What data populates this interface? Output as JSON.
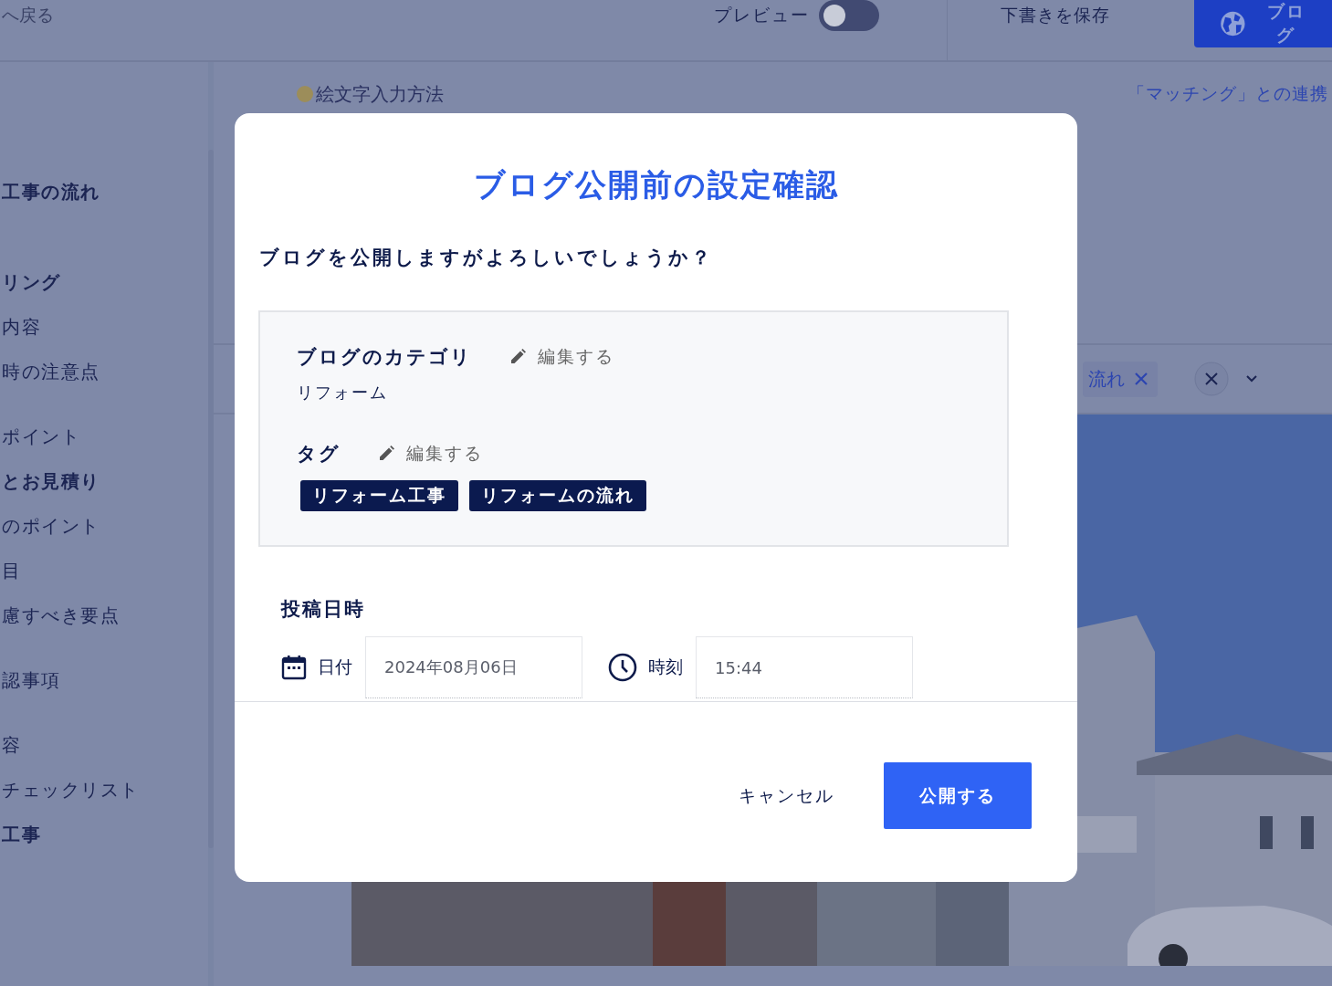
{
  "topbar": {
    "back_link": "へ戻る",
    "preview": {
      "label": "プレビュー",
      "on": false
    },
    "save_draft": "下書きを保存",
    "publish_button": "ブログ"
  },
  "sidebar": {
    "groups": [
      {
        "items": [
          {
            "label": "工事の流れ",
            "kind": "heading"
          }
        ]
      },
      {
        "items": [
          {
            "label": "リング",
            "kind": "heading"
          },
          {
            "label": "内容",
            "kind": "item"
          },
          {
            "label": "時の注意点",
            "kind": "item"
          }
        ]
      },
      {
        "items": [
          {
            "label": "ポイント",
            "kind": "item"
          },
          {
            "label": "とお見積り",
            "kind": "heading"
          },
          {
            "label": "のポイント",
            "kind": "item"
          },
          {
            "label": "目",
            "kind": "item"
          },
          {
            "label": "慮すべき要点",
            "kind": "item"
          }
        ]
      },
      {
        "items": [
          {
            "label": "認事項",
            "kind": "item"
          }
        ]
      },
      {
        "items": [
          {
            "label": "容",
            "kind": "item"
          },
          {
            "label": "チェックリスト",
            "kind": "item"
          },
          {
            "label": "工事",
            "kind": "heading"
          }
        ]
      }
    ]
  },
  "editor": {
    "emoji_help": "絵文字入力方法",
    "matching_link": "「マッチング」との連携",
    "tag_chips": [
      "流れ"
    ]
  },
  "modal": {
    "title": "ブログ公開前の設定確認",
    "question": "ブログを公開しますがよろしいでしょうか？",
    "category": {
      "label": "ブログのカテゴリ",
      "edit_label": "編集する",
      "value": "リフォーム"
    },
    "tags": {
      "label": "タグ",
      "edit_label": "編集する",
      "items": [
        "リフォーム工事",
        "リフォームの流れ"
      ]
    },
    "post_datetime": {
      "label": "投稿日時",
      "date": {
        "label": "日付",
        "value": "2024年08月06日"
      },
      "time": {
        "label": "時刻",
        "value": "15:44"
      }
    },
    "cancel_button": "キャンセル",
    "publish_button": "公開する"
  }
}
